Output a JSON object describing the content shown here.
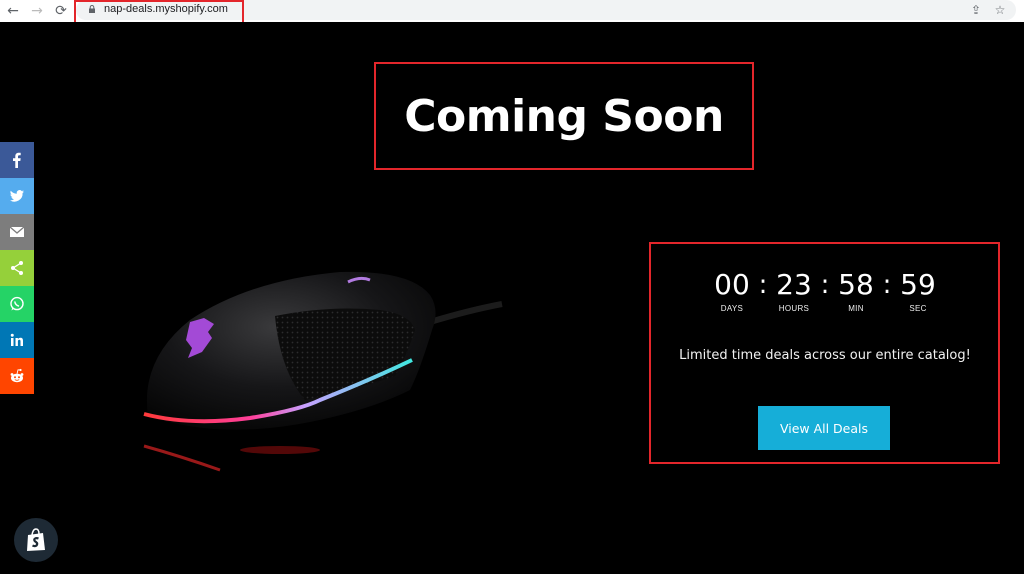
{
  "browser": {
    "back_icon": "←",
    "forward_icon": "→",
    "reload_icon": "⟳",
    "url": "nap-deals.myshopify.com",
    "share_icon": "⇪",
    "bookmark_icon": "☆"
  },
  "page": {
    "title": "Coming Soon",
    "countdown": {
      "units": [
        {
          "value": "00",
          "label": "DAYS"
        },
        {
          "value": "23",
          "label": "HOURS"
        },
        {
          "value": "58",
          "label": "MIN"
        },
        {
          "value": "59",
          "label": "SEC"
        }
      ],
      "separator": ":"
    },
    "tagline": "Limited time deals across our entire catalog!",
    "cta_label": "View All Deals"
  },
  "social_share": [
    {
      "name": "facebook",
      "color": "#3b5998"
    },
    {
      "name": "twitter",
      "color": "#55acee"
    },
    {
      "name": "email",
      "color": "#7d7d7d"
    },
    {
      "name": "share",
      "color": "#95d03a"
    },
    {
      "name": "whatsapp",
      "color": "#25d366"
    },
    {
      "name": "linkedin",
      "color": "#0077b5"
    },
    {
      "name": "reddit",
      "color": "#ff4500"
    }
  ],
  "colors": {
    "accent_button": "#16aed8",
    "highlight_border": "#e3262b"
  }
}
